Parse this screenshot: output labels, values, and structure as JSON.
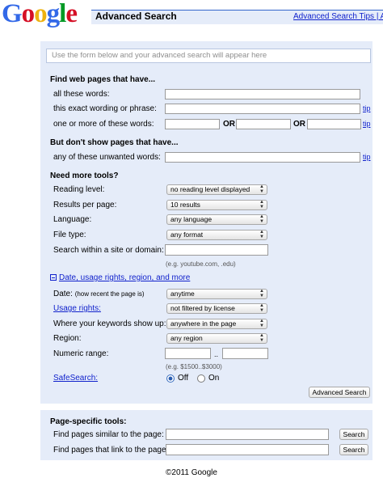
{
  "header": {
    "logo_letters": [
      {
        "ch": "G",
        "color": "#3369e8"
      },
      {
        "ch": "o",
        "color": "#d50f25"
      },
      {
        "ch": "o",
        "color": "#eeb211"
      },
      {
        "ch": "g",
        "color": "#3369e8"
      },
      {
        "ch": "l",
        "color": "#009925"
      },
      {
        "ch": "e",
        "color": "#d50f25"
      }
    ],
    "title": "Advanced Search",
    "tips_link": "Advanced Search Tips | Ab"
  },
  "preview": {
    "placeholder": "Use the form below and your advanced search will appear here"
  },
  "find": {
    "heading": "Find web pages that have...",
    "all_words": "all these words:",
    "exact_phrase": "this exact wording or phrase:",
    "one_or_more": "one or more of these words:",
    "or1": "OR",
    "or2": "OR",
    "tip1": "tip",
    "tip2": "tip"
  },
  "exclude": {
    "heading": "But don't show pages that have...",
    "unwanted": "any of these unwanted words:",
    "tip": "tip"
  },
  "tools": {
    "heading": "Need more tools?",
    "reading_level": {
      "label": "Reading level:",
      "value": "no reading level displayed"
    },
    "results_per_page": {
      "label": "Results per page:",
      "value": "10 results"
    },
    "language": {
      "label": "Language:",
      "value": "any language"
    },
    "file_type": {
      "label": "File type:",
      "value": "any format"
    },
    "site": {
      "label": "Search within a site or domain:",
      "example": "(e.g. youtube.com, .edu)"
    }
  },
  "date_section": {
    "toggle": "Date, usage rights, region, and more",
    "date": {
      "label": "Date:",
      "sub": "(how recent the page is)",
      "value": "anytime"
    },
    "usage": {
      "label": "Usage rights:",
      "value": "not filtered by license"
    },
    "where": {
      "label": "Where your keywords show up:",
      "value": "anywhere in the page"
    },
    "region": {
      "label": "Region:",
      "value": "any region"
    },
    "numeric": {
      "label": "Numeric range:",
      "sep": "..",
      "example": "(e.g. $1500..$3000)"
    },
    "safesearch": {
      "label": "SafeSearch:",
      "off": "Off",
      "on": "On",
      "selected": "Off"
    }
  },
  "submit_label": "Advanced Search",
  "page_specific": {
    "heading": "Page-specific tools:",
    "similar": {
      "label": "Find pages similar to the page:",
      "button": "Search"
    },
    "link": {
      "label": "Find pages that link to the page:",
      "button": "Search"
    }
  },
  "footer": "©2011 Google"
}
